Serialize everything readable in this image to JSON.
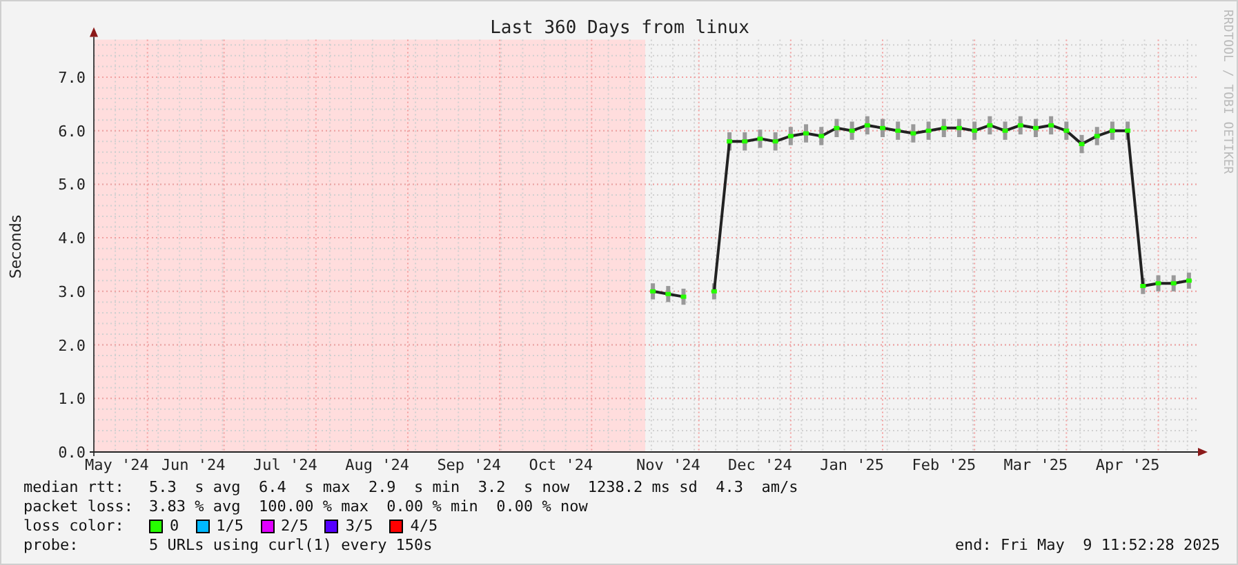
{
  "title": "Last 360 Days from linux",
  "credit": "RRDTOOL / TOBI OETIKER",
  "chart_data": {
    "type": "line",
    "ylabel": "Seconds",
    "ylim": [
      0,
      7.7
    ],
    "grid": true,
    "yticks": [
      {
        "value": 0,
        "label": "0.0"
      },
      {
        "value": 1,
        "label": "1.0"
      },
      {
        "value": 2,
        "label": "2.0"
      },
      {
        "value": 3,
        "label": "3.0"
      },
      {
        "value": 4,
        "label": "4.0"
      },
      {
        "value": 5,
        "label": "5.0"
      },
      {
        "value": 6,
        "label": "6.0"
      },
      {
        "value": 7,
        "label": "7.0"
      }
    ],
    "categories": [
      null,
      "May '24",
      null,
      null,
      null,
      null,
      "Jun '24",
      null,
      null,
      null,
      null,
      null,
      "Jul '24",
      null,
      null,
      null,
      null,
      null,
      "Aug '24",
      null,
      null,
      null,
      null,
      null,
      "Sep '24",
      null,
      null,
      null,
      null,
      null,
      "Oct '24",
      null,
      null,
      null,
      null,
      null,
      null,
      "Nov '24",
      null,
      null,
      null,
      null,
      null,
      "Dec '24",
      null,
      null,
      null,
      null,
      null,
      "Jan '25",
      null,
      null,
      null,
      null,
      null,
      "Feb '25",
      null,
      null,
      null,
      null,
      null,
      "Mar '25",
      null,
      null,
      null,
      null,
      null,
      "Apr '25",
      null,
      null,
      null,
      null
    ],
    "series": [
      {
        "color": "#222222",
        "marker": "square",
        "values": [
          null,
          null,
          null,
          null,
          null,
          null,
          null,
          null,
          null,
          null,
          null,
          null,
          null,
          null,
          null,
          null,
          null,
          null,
          null,
          null,
          null,
          null,
          null,
          null,
          null,
          null,
          null,
          null,
          null,
          null,
          null,
          null,
          null,
          null,
          null,
          null,
          3.0,
          2.95,
          2.9,
          null,
          3.0,
          5.8,
          5.8,
          5.85,
          5.8,
          5.9,
          5.95,
          5.9,
          6.05,
          6.0,
          6.1,
          6.05,
          6.0,
          5.95,
          6.0,
          6.05,
          6.05,
          6.0,
          6.1,
          6.0,
          6.1,
          6.05,
          6.1,
          6.0,
          5.75,
          5.9,
          6.0,
          6.0,
          3.1,
          3.15,
          3.15,
          3.2
        ],
        "errors": [
          null,
          null,
          null,
          null,
          null,
          null,
          null,
          null,
          null,
          null,
          null,
          null,
          null,
          null,
          null,
          null,
          null,
          null,
          null,
          null,
          null,
          null,
          null,
          null,
          null,
          null,
          null,
          null,
          null,
          null,
          null,
          null,
          null,
          null,
          null,
          null,
          0.15,
          0.15,
          0.15,
          null,
          0.15,
          0.17,
          0.17,
          0.17,
          0.17,
          0.17,
          0.17,
          0.17,
          0.17,
          0.17,
          0.17,
          0.17,
          0.17,
          0.17,
          0.17,
          0.17,
          0.17,
          0.17,
          0.17,
          0.17,
          0.17,
          0.17,
          0.17,
          0.17,
          0.17,
          0.17,
          0.17,
          0.17,
          0.15,
          0.15,
          0.15,
          0.15
        ]
      }
    ]
  },
  "stats": [
    {
      "label": "median rtt:",
      "text": "5.3  s avg  6.4  s max  2.9  s min  3.2  s now  1238.2 ms sd  4.3  am/s"
    },
    {
      "label": "packet loss:",
      "text": "3.83 % avg  100.00 % max  0.00 % min  0.00 % now"
    }
  ],
  "loss_colors": {
    "label": "loss color:",
    "items": [
      {
        "text": "0",
        "color": "#26ff00"
      },
      {
        "text": "1/5",
        "color": "#00b8ff"
      },
      {
        "text": "2/5",
        "color": "#e000ff"
      },
      {
        "text": "3/5",
        "color": "#5500ff"
      },
      {
        "text": "4/5",
        "color": "#ff0000"
      }
    ]
  },
  "probe": {
    "label": "probe:",
    "text": "5 URLs using curl(1) every 150s"
  },
  "end": "end: Fri May  9 11:52:28 2025"
}
